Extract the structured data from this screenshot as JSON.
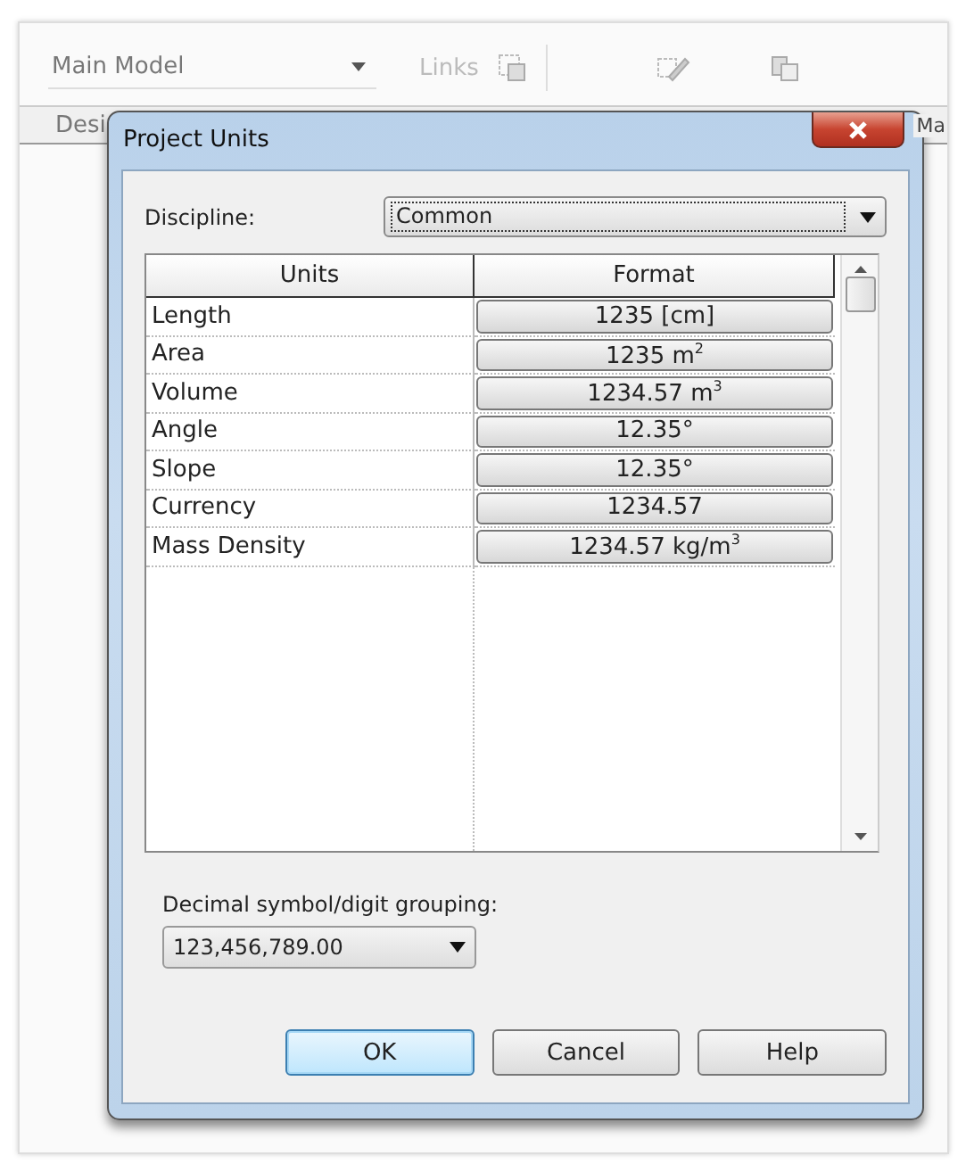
{
  "app": {
    "model_selector": {
      "value": "Main Model"
    },
    "links_label": "Links",
    "tab_labels": [
      "Desi",
      "Ma"
    ]
  },
  "dialog": {
    "title": "Project Units",
    "discipline": {
      "label": "Discipline:",
      "value": "Common"
    },
    "table": {
      "columns": [
        "Units",
        "Format"
      ],
      "rows": [
        {
          "unit": "Length",
          "format": "1235 [cm]"
        },
        {
          "unit": "Area",
          "format": "1235 m$^{2}$"
        },
        {
          "unit": "Volume",
          "format": "1234.57 m$^{3}$"
        },
        {
          "unit": "Angle",
          "format": "12.35°"
        },
        {
          "unit": "Slope",
          "format": "12.35°"
        },
        {
          "unit": "Currency",
          "format": "1234.57"
        },
        {
          "unit": "Mass Density",
          "format": "1234.57 kg/m$^{3}$"
        }
      ]
    },
    "grouping": {
      "label": "Decimal symbol/digit grouping:",
      "value": "123,456,789.00"
    },
    "buttons": [
      {
        "label": "OK",
        "default": true
      },
      {
        "label": "Cancel",
        "default": false
      },
      {
        "label": "Help",
        "default": false
      }
    ]
  }
}
